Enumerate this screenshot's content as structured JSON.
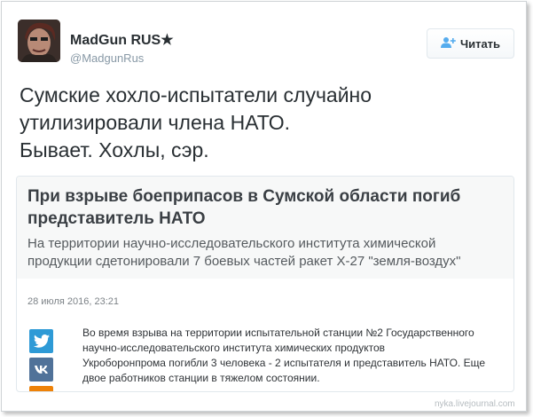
{
  "author": {
    "name": "MadGun RUS★",
    "handle": "@MadgunRus"
  },
  "follow_button": {
    "label": "Читать",
    "icon": "add-user-icon"
  },
  "tweet": {
    "lines": [
      "Сумские хохло-испытатели случайно",
      "утилизировали члена НАТО.",
      "Бывает. Хохлы, сэр."
    ]
  },
  "card": {
    "title_lines": [
      "При взрыве боеприпасов в Сумской области погиб",
      "представитель НАТО"
    ],
    "subtitle_lines": [
      "На территории научно-исследовательского института химической",
      "продукции сдетонировали 7 боевых частей ракет Х-27 \"земля-воздух\""
    ],
    "date": "28 июля 2016, 23:21",
    "body_lines": [
      "Во время взрыва на территории испытательной станции №2 Государственного",
      "научно-исследовательского института химических продуктов",
      "Укроборонпрома погибли 3 человека - 2 испытателя и представитель НАТО. Еще",
      "двое работников станции в тяжелом состоянии."
    ],
    "share_icons": [
      "twitter-icon",
      "vk-icon",
      "odnoklassniki-icon"
    ]
  },
  "watermark": "nyka.livejournal.com",
  "colors": {
    "twitter": "#2e9ad6",
    "vk": "#507299",
    "ok": "#ee8208",
    "text": "#292f33",
    "muted": "#8899a6"
  }
}
